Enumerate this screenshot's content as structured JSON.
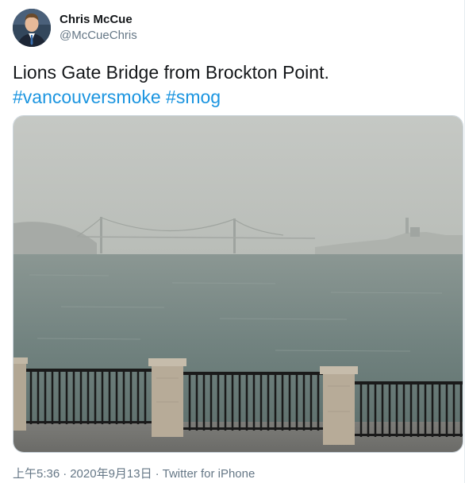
{
  "author": {
    "display_name": "Chris McCue",
    "handle": "@McCueChris",
    "avatar_icon": "profile-photo"
  },
  "tweet": {
    "text": "Lions Gate Bridge from Brockton Point.",
    "hashtags": [
      "#vancouversmoke",
      "#smog"
    ]
  },
  "media": {
    "icon": "photo-lions-gate-bridge-smoke",
    "colors": {
      "sky": "#bfc3bf",
      "water": "#6f7f7c",
      "railing": "#1a1a1a",
      "pillar": "#b7ab98"
    }
  },
  "meta": {
    "time": "上午5:36",
    "date": "2020年9月13日",
    "source": "Twitter for iPhone",
    "separator": "·"
  },
  "colors": {
    "link": "#1b95e0",
    "secondary_text": "#657786"
  }
}
